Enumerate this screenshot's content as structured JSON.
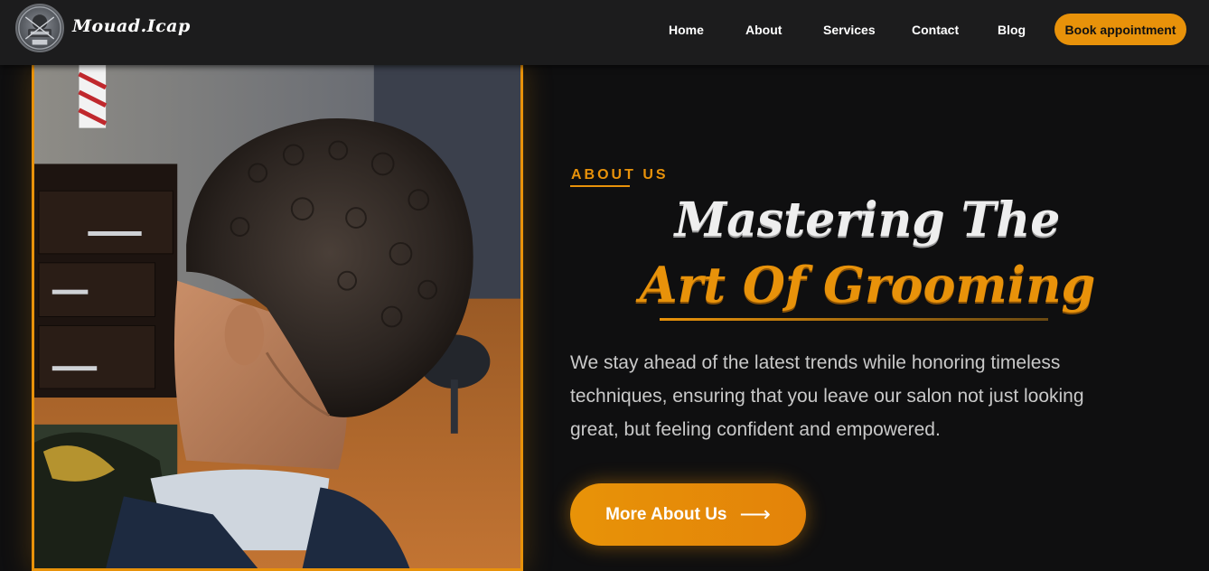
{
  "header": {
    "brand": "Mouad.Icap",
    "nav": {
      "home": "Home",
      "about": "About",
      "services": "Services",
      "contact": "Contact",
      "blog": "Blog"
    },
    "book_button": "Book appointment"
  },
  "hero": {
    "eyebrow": "ABOUT US",
    "headline_line1": "Mastering The",
    "headline_line2": "Art Of Grooming",
    "description": "We stay ahead of the latest trends while honoring timeless techniques, ensuring that you leave our salon not just looking great, but feeling confident and empowered.",
    "cta_label": "More About Us",
    "cta_icon": "arrow-right-icon"
  },
  "colors": {
    "accent": "#e8920a",
    "background": "#0f0f10",
    "navbar": "#1c1c1d",
    "text_light": "#c9c9c9"
  }
}
